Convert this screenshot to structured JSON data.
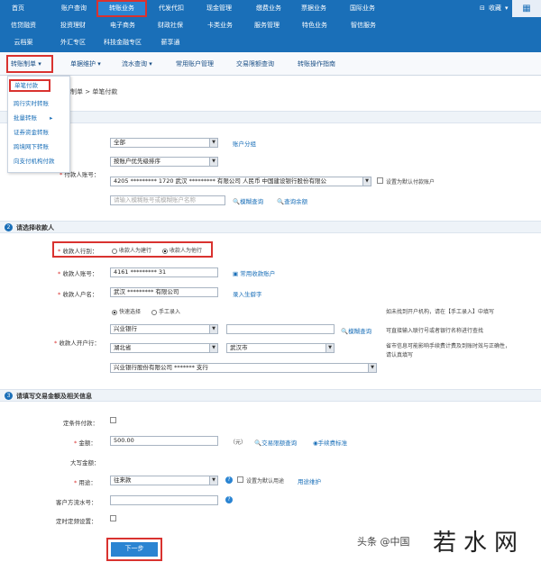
{
  "topnav": {
    "row1": [
      "首页",
      "账户查询",
      "转账业务",
      "代发代扣",
      "现金管理",
      "缴费业务",
      "票据业务",
      "国际业务"
    ],
    "row2": [
      "信贷融资",
      "投资理财",
      "电子商务",
      "财政社保",
      "卡类业务",
      "服务管理",
      "特色业务",
      "智信服务"
    ],
    "row3": [
      "云档案",
      "外汇专区",
      "科技金融专区",
      "薪享通"
    ],
    "fav": "收藏",
    "grid_icon": "grid-icon"
  },
  "subnav": [
    "转账制单",
    "单据维护",
    "流水查询",
    "常用账户管理",
    "交易限额查询",
    "转账操作指南"
  ],
  "dropdown": [
    "单笔付款",
    "跨行实时转账",
    "批量转账",
    "证券资金转账",
    "跨境网下转账",
    "向支付机构付款"
  ],
  "breadcrumb": "转账制单 > 单笔付款",
  "payer": {
    "group_value": "全部",
    "group_link": "账户分组",
    "sort_value": "按账户优先级排序",
    "account_label": "付款人账号：",
    "account_value": "4205 ********* 1720 武汉 ********* 有限公司 人民币 中国建设银行股份有限公",
    "default_label": "设置为默认付款账户",
    "search_placeholder": "请输入模糊账号或模糊账户名称",
    "fuzzy": "模糊查询",
    "balance": "查询余额"
  },
  "section2": {
    "num": "2",
    "title": "请选择收款人"
  },
  "payee": {
    "type_label": "收款人行别：",
    "opt1": "收款人为建行",
    "opt2": "收款人为他行",
    "account_label": "收款人账号：",
    "account_value": "4161 ********* 31",
    "common_link": "常用收款账户",
    "name_label": "收款人户名：",
    "name_value": "武汉 ********* 有限公司",
    "name_link": "录入生僻字",
    "quick": "快速选择",
    "manual": "手工录入",
    "bank_label": "收款人开户行：",
    "bank_value": "兴业银行",
    "fuzzy": "模糊查询",
    "province": "湖北省",
    "city": "武汉市",
    "branch": "兴业银行股份有限公司 ******* 支行",
    "note1": "如未找到开户机构，请在【手工录入】中填写",
    "note2": "可直接输入联行号或者银行名称进行查找",
    "note3": "省市信息可能影响手续费计费及到账时效与正确性，",
    "note4": "请认真填写"
  },
  "section3": {
    "num": "3",
    "title": "请填写交易金额及相关信息"
  },
  "txn": {
    "cond_label": "定条件付款：",
    "amount_label": "金额：",
    "amount_value": "500.00",
    "unit": "（元）",
    "limit_link": "交易限额查询",
    "fee_link": "手续费标准",
    "caps_label": "大写金额：",
    "purpose_label": "用途：",
    "purpose_value": "往来款",
    "default_purpose": "设置为默认用途",
    "maintain": "用途维护",
    "serial_label": "客户方流水号：",
    "timing_label": "定时定频设置："
  },
  "next": "下一步",
  "watermark": {
    "source": "头条 @中国",
    "brand": "若水网"
  }
}
